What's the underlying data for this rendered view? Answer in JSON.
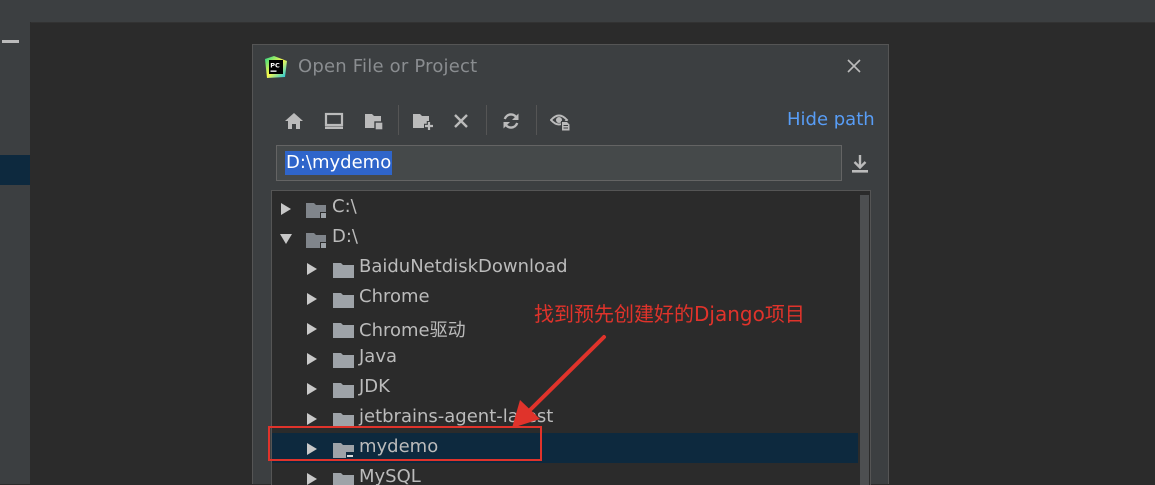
{
  "dialog": {
    "title": "Open File or Project",
    "hide_path_label": "Hide path",
    "path_value": "D:\\mydemo"
  },
  "toolbar": {
    "icons": [
      "home-icon",
      "desktop-icon",
      "project-folder-icon",
      "new-folder-icon",
      "delete-icon",
      "refresh-icon",
      "show-hidden-files-icon"
    ]
  },
  "tree": {
    "items": [
      {
        "label": "C:\\",
        "expanded": false,
        "selected": false
      },
      {
        "label": "D:\\",
        "expanded": true,
        "selected": false
      },
      {
        "label": "BaiduNetdiskDownload",
        "expanded": false,
        "selected": false
      },
      {
        "label": "Chrome",
        "expanded": false,
        "selected": false
      },
      {
        "label": "Chrome驱动",
        "expanded": false,
        "selected": false
      },
      {
        "label": "Java",
        "expanded": false,
        "selected": false
      },
      {
        "label": "JDK",
        "expanded": false,
        "selected": false
      },
      {
        "label": "jetbrains-agent-latest",
        "expanded": false,
        "selected": false
      },
      {
        "label": "mydemo",
        "expanded": false,
        "selected": true
      },
      {
        "label": "MySQL",
        "expanded": false,
        "selected": false
      }
    ]
  },
  "annotation": {
    "text": "找到预先创建好的Django项目",
    "color": "#e0332b"
  },
  "colors": {
    "accent": "#589df6",
    "selection": "#0d293e",
    "text_selection": "#2f65ca"
  }
}
